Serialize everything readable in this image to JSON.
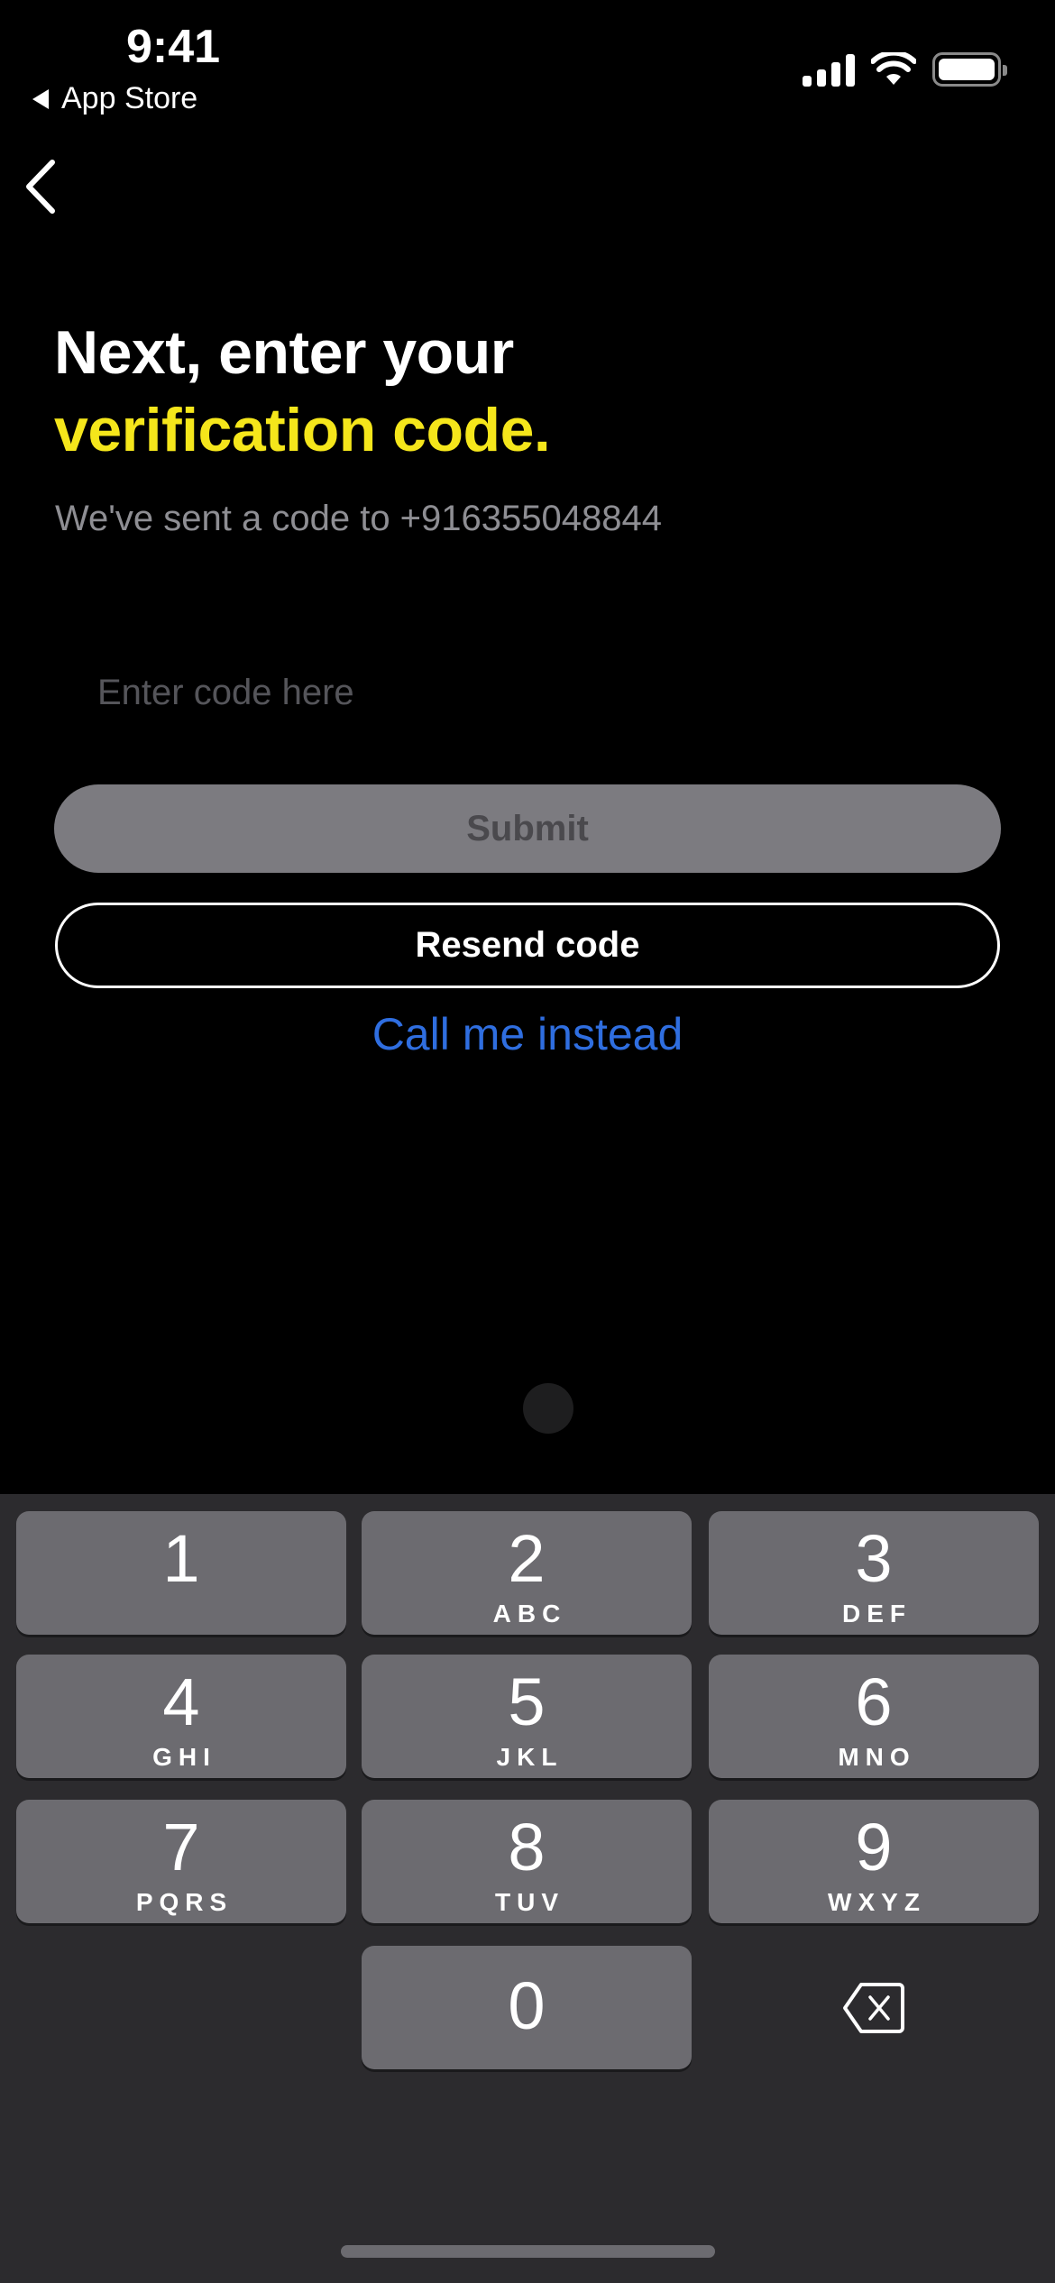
{
  "status_bar": {
    "time": "9:41",
    "back_app_label": "App Store",
    "icons": [
      "cellular-signal-icon",
      "wifi-icon",
      "battery-icon"
    ]
  },
  "nav": {
    "back_icon": "chevron-left-icon"
  },
  "headline": {
    "line1": "Next, enter your",
    "line2": "verification code."
  },
  "subtitle": "We've sent a code to +916355048844",
  "code_input": {
    "value": "",
    "placeholder": "Enter code here"
  },
  "buttons": {
    "submit": "Submit",
    "resend": "Resend code",
    "call": "Call me instead"
  },
  "colors": {
    "accent_yellow": "#f5e61b",
    "link_blue": "#2f6ee0",
    "submit_disabled_bg": "#7c7b80",
    "keyboard_bg": "#2c2b2e",
    "key_bg": "#6c6b70"
  },
  "keypad": {
    "keys": [
      {
        "digit": "1",
        "letters": ""
      },
      {
        "digit": "2",
        "letters": "ABC"
      },
      {
        "digit": "3",
        "letters": "DEF"
      },
      {
        "digit": "4",
        "letters": "GHI"
      },
      {
        "digit": "5",
        "letters": "JKL"
      },
      {
        "digit": "6",
        "letters": "MNO"
      },
      {
        "digit": "7",
        "letters": "PQRS"
      },
      {
        "digit": "8",
        "letters": "TUV"
      },
      {
        "digit": "9",
        "letters": "WXYZ"
      },
      {
        "digit": "0",
        "letters": ""
      }
    ],
    "delete_icon": "backspace-icon"
  }
}
